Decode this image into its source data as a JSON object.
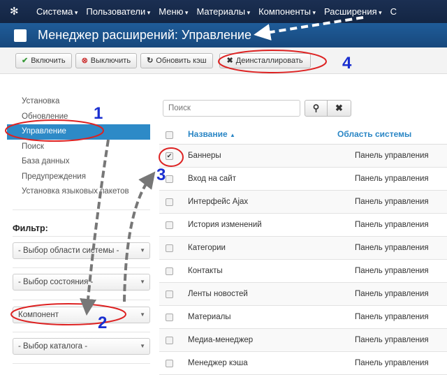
{
  "nav": [
    "Система",
    "Пользователи",
    "Меню",
    "Материалы",
    "Компоненты",
    "Расширения",
    "С"
  ],
  "header": {
    "title": "Менеджер расширений: Управление"
  },
  "toolbar": {
    "enable": "Включить",
    "disable": "Выключить",
    "refresh": "Обновить кэш",
    "uninstall": "Деинсталлировать"
  },
  "sidebar": {
    "items": [
      "Установка",
      "Обновление",
      "Управление",
      "Поиск",
      "База данных",
      "Предупреждения",
      "Установка языковых пакетов"
    ]
  },
  "filter": {
    "label": "Фильтр:",
    "selects": [
      "- Выбор области системы -",
      "- Выбор состояния -",
      "Компонент",
      "- Выбор каталога -"
    ]
  },
  "search": {
    "placeholder": "Поиск"
  },
  "table": {
    "col_name": "Название",
    "col_area": "Область системы",
    "rows": [
      {
        "name": "Баннеры",
        "area": "Панель управления",
        "checked": true
      },
      {
        "name": "Вход на сайт",
        "area": "Панель управления",
        "checked": false
      },
      {
        "name": "Интерфейс Ajax",
        "area": "Панель управления",
        "checked": false
      },
      {
        "name": "История изменений",
        "area": "Панель управления",
        "checked": false
      },
      {
        "name": "Категории",
        "area": "Панель управления",
        "checked": false
      },
      {
        "name": "Контакты",
        "area": "Панель управления",
        "checked": false
      },
      {
        "name": "Ленты новостей",
        "area": "Панель управления",
        "checked": false
      },
      {
        "name": "Материалы",
        "area": "Панель управления",
        "checked": false
      },
      {
        "name": "Медиа-менеджер",
        "area": "Панель управления",
        "checked": false
      },
      {
        "name": "Менеджер кэша",
        "area": "Панель управления",
        "checked": false
      }
    ]
  },
  "annotations": [
    "1",
    "2",
    "3",
    "4"
  ]
}
